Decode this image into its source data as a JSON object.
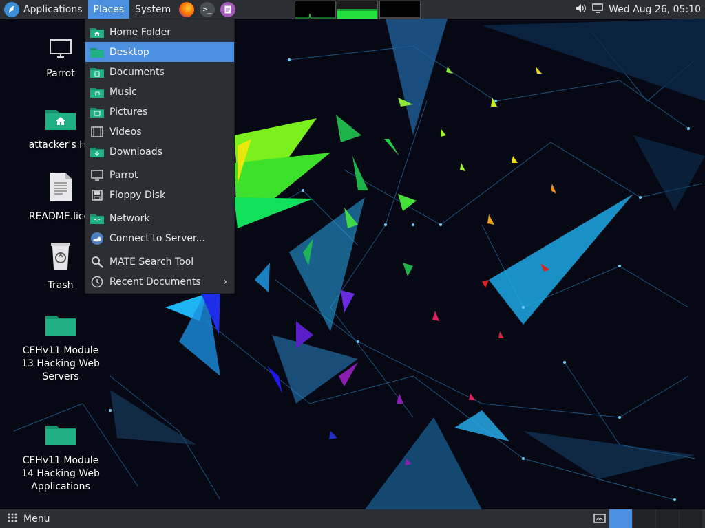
{
  "top_panel": {
    "menus": [
      "Applications",
      "Places",
      "System"
    ],
    "launchers": [
      "firefox-icon",
      "terminal-icon",
      "text-editor-icon"
    ],
    "tray": {
      "datetime": "Wed Aug 26, 05:10"
    }
  },
  "places_menu": {
    "items": [
      {
        "label": "Home Folder",
        "icon": "home-folder-icon"
      },
      {
        "label": "Desktop",
        "icon": "desktop-folder-icon"
      },
      {
        "label": "Documents",
        "icon": "documents-folder-icon"
      },
      {
        "label": "Music",
        "icon": "music-folder-icon"
      },
      {
        "label": "Pictures",
        "icon": "pictures-folder-icon"
      },
      {
        "label": "Videos",
        "icon": "videos-folder-icon"
      },
      {
        "label": "Downloads",
        "icon": "downloads-folder-icon"
      },
      {
        "label": "Parrot",
        "icon": "computer-icon"
      },
      {
        "label": "Floppy Disk",
        "icon": "floppy-icon"
      },
      {
        "label": "Network",
        "icon": "network-folder-icon"
      },
      {
        "label": "Connect to Server...",
        "icon": "server-icon"
      },
      {
        "label": "MATE Search Tool",
        "icon": "search-icon"
      },
      {
        "label": "Recent Documents",
        "icon": "clock-icon"
      }
    ],
    "selected": "Desktop"
  },
  "desktop_icons": [
    {
      "label": "Parrot",
      "icon": "computer-icon"
    },
    {
      "label": "attacker's Ho",
      "icon": "home-folder-icon"
    },
    {
      "label": "README.licei",
      "icon": "text-file-icon"
    },
    {
      "label": "Trash",
      "icon": "trash-icon"
    },
    {
      "label": "CEHv11 Module 13 Hacking Web Servers",
      "icon": "folder-icon"
    },
    {
      "label": "CEHv11 Module 14 Hacking Web Applications",
      "icon": "folder-icon"
    }
  ],
  "bottom_panel": {
    "menu_label": "Menu"
  },
  "colors": {
    "panel": "#2b2f33",
    "accent": "#4b8fe0",
    "folder": "#1aa37a"
  }
}
